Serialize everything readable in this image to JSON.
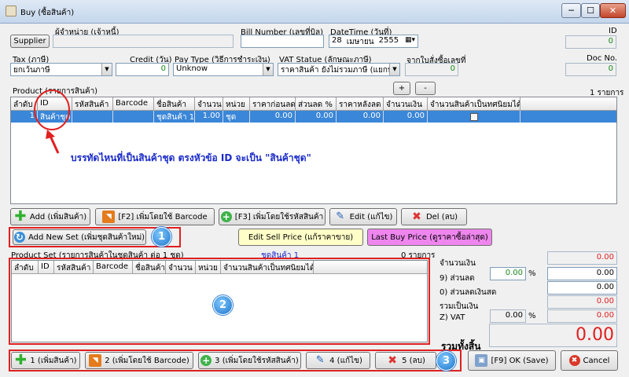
{
  "window": {
    "title": "Buy (ซื้อสินค้า)",
    "minimize": "─",
    "maximize": "☐",
    "close": "✕"
  },
  "header": {
    "supplier_caption": "ผู้จำหน่าย (เจ้าหนี้)",
    "supplier_button": "Supplier",
    "supplier_value": "",
    "bill_caption": "Bill Number (เลขที่บิล)",
    "bill_value": "",
    "datetime_caption": "DateTime (วันที่)",
    "date_day": "28",
    "date_month": "เมษายน",
    "date_year": "2555",
    "id_caption": "ID",
    "id_value": "0"
  },
  "row2": {
    "tax_caption": "Tax (ภาษี)",
    "tax_value": "ยกเว้นภาษี",
    "credit_caption": "Credit (วัน)",
    "credit_value": "0",
    "paytype_caption": "Pay Type (วิธีการชำระเงิน)",
    "paytype_value": "Unknow",
    "vat_caption": "VAT Statue (ลักษณะภาษี)",
    "vat_value": "ราคาสินค้า ยังไม่รวมภาษี (แยกนอก)",
    "po_caption": "จากใบสั่งซื้อเลขที่",
    "po_value": "0",
    "docno_caption": "Doc No.",
    "docno_value": "0"
  },
  "product": {
    "caption": "Product (รายการสินค้า)",
    "add_row": "+",
    "remove_row": "-",
    "count": "1 รายการ",
    "columns": [
      "ลำดับ",
      "ID",
      "รหัสสินค้า",
      "Barcode",
      "ชื่อสินค้า",
      "จำนวน",
      "หน่วย",
      "ราคาก่อนลด",
      "ส่วนลด %",
      "ราคาหลังลด",
      "จำนวนเงิน",
      "จำนวนสินค้าเป็นทศนิยมได้"
    ],
    "rows": [
      {
        "no": "1",
        "id": "สินค้าชุด",
        "code": "",
        "barcode": "",
        "name": "ชุดสินค้า 1",
        "qty": "1.00",
        "unit": "ชุด",
        "price": "0.00",
        "disc": "0.00",
        "net": "0.00",
        "amount": "0.00"
      }
    ],
    "annotation": "บรรทัดไหนที่เป็นสินค้าชุด ตรงหัวข้อ ID จะเป็น \"สินค้าชุด\""
  },
  "product_buttons": {
    "add": "Add (เพิ่มสินค้า)",
    "barcode": "[F2] เพิ่มโดยใช้ Barcode",
    "code": "[F3] เพิ่มโดยใช้รหัสสินค้า",
    "edit": "Edit (แก้ไข)",
    "del": "Del (ลบ)"
  },
  "set_bar": {
    "add_new_set": "Add New Set (เพิ่มชุดสินค้าใหม่)",
    "edit_sell_price": "Edit Sell Price (แก้ราคาขาย)",
    "last_buy_price": "Last Buy Price (ดูราคาซื้อล่าสุด)"
  },
  "product_set": {
    "caption": "Product Set (รายการสินค้าในชุดสินค้า ต่อ 1 ชุด)",
    "set_name": "ชุดสินค้า 1",
    "count": "0 รายการ",
    "columns": [
      "ลำดับ",
      "ID",
      "รหัสสินค้า",
      "Barcode",
      "ชื่อสินค้า",
      "จำนวน",
      "หน่วย",
      "จำนวนสินค้าเป็นทศนิยมได้"
    ]
  },
  "totals": {
    "amount_label": "จำนวนเงิน",
    "amount_value": "0.00",
    "discount_label": "9) ส่วนลด",
    "discount_pct": "0.00",
    "pct_sign": "%",
    "discount_value": "0.00",
    "cash_discount_label": "0) ส่วนลดเงินสด",
    "cash_discount_value": "0.00",
    "subtotal_label": "รวมเป็นเงิน",
    "subtotal_value": "0.00",
    "vat_label": "Z) VAT",
    "vat_pct": "0.00",
    "vat_value": "0.00",
    "grand_label": "รวมทั้งสิ้น",
    "grand_value": "0.00"
  },
  "set_buttons": {
    "b1": "1 (เพิ่มสินค้า)",
    "b2": "2 (เพิ่มโดยใช้ Barcode)",
    "b3": "3 (เพิ่มโดยใช้รหัสสินค้า)",
    "b4": "4 (แก้ไข)",
    "b5": "5 (ลบ)"
  },
  "footer": {
    "ok": "[F9] OK (Save)",
    "cancel": "Cancel"
  },
  "callouts": {
    "c1": "1",
    "c2": "2",
    "c3": "3"
  },
  "colors": {
    "selection": "#3a86d8",
    "red_total": "#e02020",
    "annotation": "#1a2bc8",
    "highlight_box": "#e02020"
  }
}
